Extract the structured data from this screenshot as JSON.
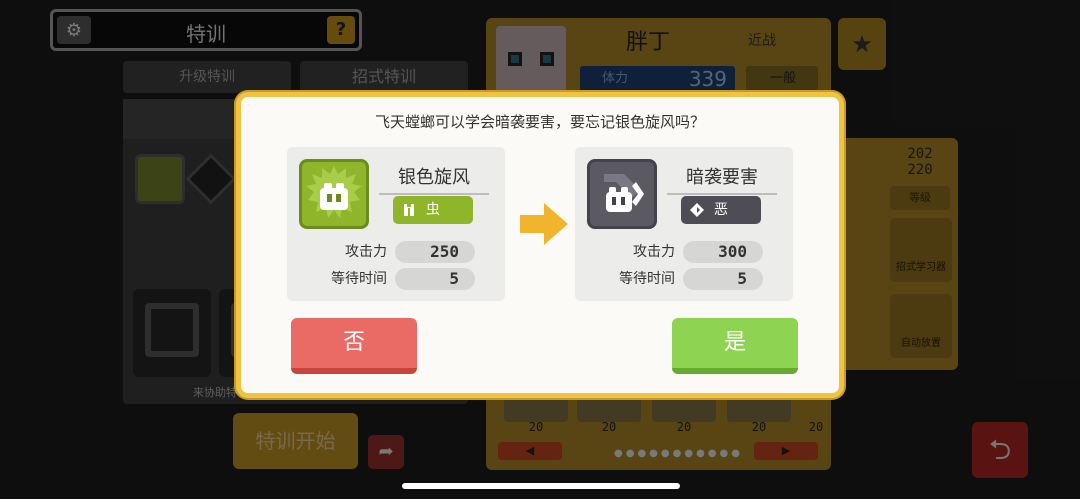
{
  "header": {
    "title": "特训",
    "help": "?"
  },
  "tabs": [
    "升级特训",
    "招式特训"
  ],
  "left_panel": {
    "bottom_label": "来协助特",
    "start_button": "特训开始"
  },
  "pokemon": {
    "name": "胖丁",
    "style": "近战",
    "hp_label": "体力",
    "hp_value": "339",
    "rank": "一般"
  },
  "side": {
    "level_current": "202",
    "level_max": "220",
    "level_label": "等级",
    "learn_button": "招式学习器",
    "auto_button": "自动放置"
  },
  "grid_bottom": {
    "values": [
      "20",
      "20",
      "20",
      "20",
      "20"
    ],
    "dots": "●●●●●●●●●●●"
  },
  "dialog": {
    "question": "飞天螳螂可以学会暗袭要害，要忘记银色旋风吗？",
    "old_move": {
      "name": "银色旋风",
      "type": "虫",
      "attack_label": "攻击力",
      "attack": "250",
      "wait_label": "等待时间",
      "wait": "5"
    },
    "new_move": {
      "name": "暗袭要害",
      "type": "恶",
      "attack_label": "攻击力",
      "attack": "300",
      "wait_label": "等待时间",
      "wait": "5"
    },
    "no_button": "否",
    "yes_button": "是"
  },
  "colors": {
    "dialog_border": "#f0c443",
    "bug": "#8fb52b",
    "dark": "#4e4d56",
    "no": "#ea6a65",
    "yes": "#8ed452",
    "arrow": "#f0b52c"
  }
}
